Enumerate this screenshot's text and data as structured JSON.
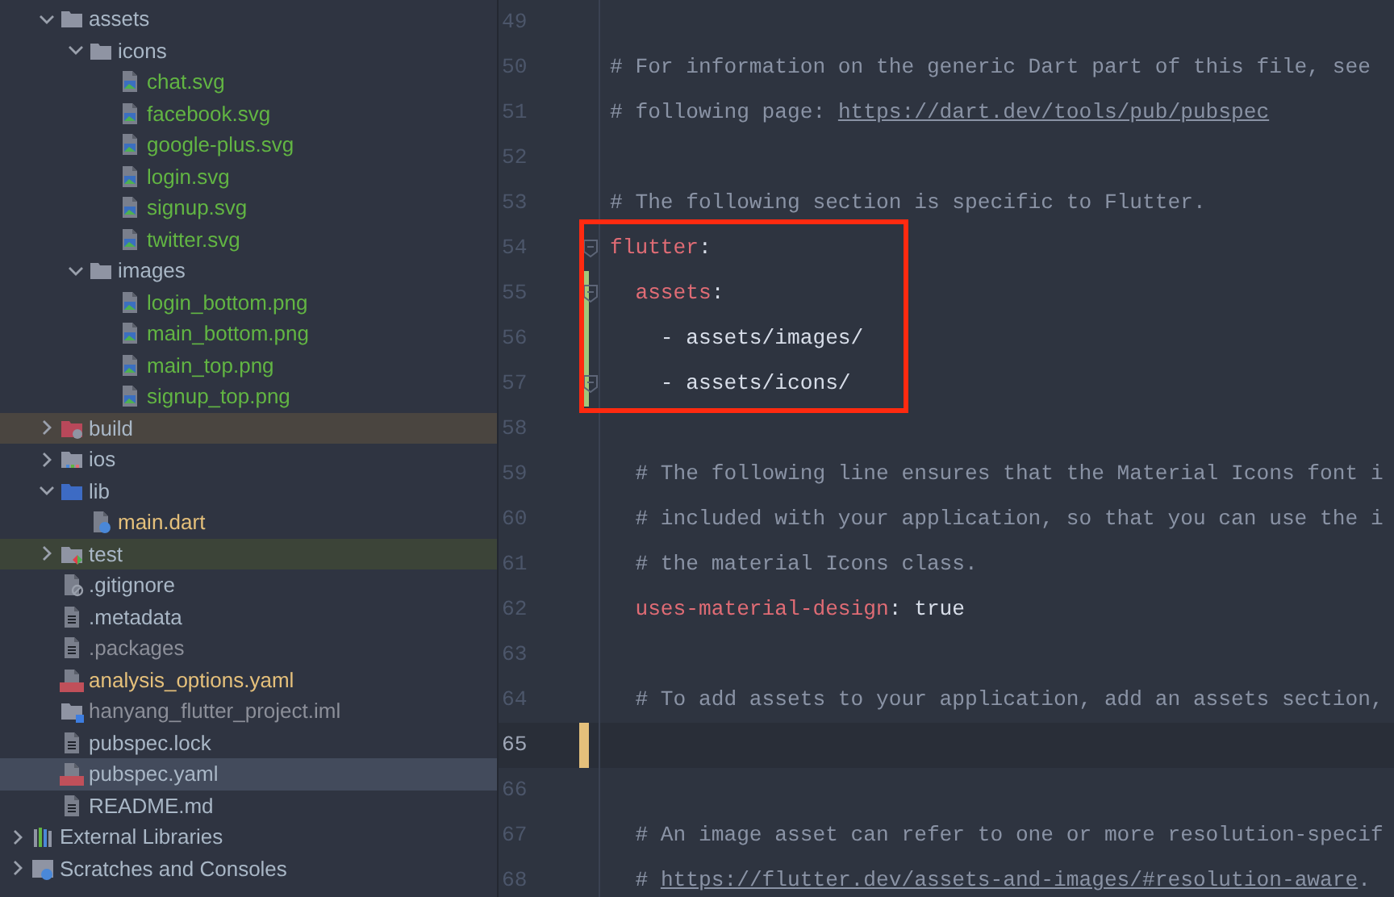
{
  "project_tree": [
    {
      "label": "assets",
      "kind": "folder",
      "expanded": true,
      "selected": false,
      "color": "#a9b7c6",
      "children": [
        {
          "label": "icons",
          "kind": "folder",
          "expanded": true,
          "selected": false,
          "color": "#a9b7c6",
          "children": [
            {
              "label": "chat.svg",
              "kind": "image",
              "selected": false,
              "color": "#62b543"
            },
            {
              "label": "facebook.svg",
              "kind": "image",
              "selected": false,
              "color": "#62b543"
            },
            {
              "label": "google-plus.svg",
              "kind": "image",
              "selected": false,
              "color": "#62b543"
            },
            {
              "label": "login.svg",
              "kind": "image",
              "selected": false,
              "color": "#62b543"
            },
            {
              "label": "signup.svg",
              "kind": "image",
              "selected": false,
              "color": "#62b543"
            },
            {
              "label": "twitter.svg",
              "kind": "image",
              "selected": false,
              "color": "#62b543"
            }
          ]
        },
        {
          "label": "images",
          "kind": "folder",
          "expanded": true,
          "selected": false,
          "color": "#a9b7c6",
          "children": [
            {
              "label": "login_bottom.png",
              "kind": "image",
              "selected": false,
              "color": "#62b543"
            },
            {
              "label": "main_bottom.png",
              "kind": "image",
              "selected": false,
              "color": "#62b543"
            },
            {
              "label": "main_top.png",
              "kind": "image",
              "selected": false,
              "color": "#62b543"
            },
            {
              "label": "signup_top.png",
              "kind": "image",
              "selected": false,
              "color": "#62b543"
            }
          ]
        }
      ]
    },
    {
      "label": "build",
      "kind": "excluded-folder",
      "expanded": false,
      "selected": false,
      "color": "#a9b7c6"
    },
    {
      "label": "ios",
      "kind": "ios-folder",
      "expanded": false,
      "selected": false,
      "color": "#a9b7c6"
    },
    {
      "label": "lib",
      "kind": "source-folder",
      "expanded": true,
      "selected": false,
      "color": "#a9b7c6",
      "children": [
        {
          "label": "main.dart",
          "kind": "dart",
          "selected": false,
          "color": "#e5c07b"
        }
      ]
    },
    {
      "label": "test",
      "kind": "test-folder",
      "expanded": false,
      "selected": false,
      "color": "#a9b7c6"
    },
    {
      "label": ".gitignore",
      "kind": "ignore",
      "selected": false,
      "color": "#a9b7c6"
    },
    {
      "label": ".metadata",
      "kind": "text",
      "selected": false,
      "color": "#a9b7c6"
    },
    {
      "label": ".packages",
      "kind": "text",
      "selected": false,
      "color": "#8c8f99"
    },
    {
      "label": "analysis_options.yaml",
      "kind": "yaml",
      "selected": false,
      "color": "#e5c07b"
    },
    {
      "label": "hanyang_flutter_project.iml",
      "kind": "module",
      "selected": false,
      "color": "#8c8f99"
    },
    {
      "label": "pubspec.lock",
      "kind": "text",
      "selected": false,
      "color": "#a9b7c6"
    },
    {
      "label": "pubspec.yaml",
      "kind": "yaml",
      "selected": true,
      "color": "#a9b7c6"
    },
    {
      "label": "README.md",
      "kind": "text",
      "selected": false,
      "color": "#a9b7c6"
    }
  ],
  "root_items": [
    {
      "label": "External Libraries",
      "kind": "libraries",
      "expanded": false
    },
    {
      "label": "Scratches and Consoles",
      "kind": "scratches",
      "expanded": false
    }
  ],
  "editor": {
    "lines": [
      {
        "number": "49"
      },
      {
        "number": "50",
        "spans": [
          {
            "kind": "comment",
            "text": "# For information on the generic Dart part of this file, see"
          }
        ]
      },
      {
        "number": "51",
        "spans": [
          {
            "kind": "comment",
            "text": "# following page: "
          },
          {
            "kind": "link",
            "text": "https://dart.dev/tools/pub/pubspec"
          }
        ]
      },
      {
        "number": "52"
      },
      {
        "number": "53",
        "spans": [
          {
            "kind": "comment",
            "text": "# The following section is specific to Flutter."
          }
        ]
      },
      {
        "number": "54",
        "fold": true,
        "boxed": true,
        "spans": [
          {
            "kind": "key",
            "text": "flutter"
          },
          {
            "kind": "plain",
            "text": ":"
          }
        ]
      },
      {
        "number": "55",
        "fold": true,
        "boxed": true,
        "color": "#a3c77a",
        "spans": [
          {
            "kind": "key",
            "text": "  assets"
          },
          {
            "kind": "plain",
            "text": ":"
          }
        ]
      },
      {
        "number": "56",
        "boxed": true,
        "color": "#a3c77a",
        "spans": [
          {
            "kind": "plain",
            "text": "    - assets/images/"
          }
        ]
      },
      {
        "number": "57",
        "fold": true,
        "boxed": true,
        "color": "#a3c77a",
        "spans": [
          {
            "kind": "plain",
            "text": "    - assets/icons/"
          }
        ]
      },
      {
        "number": "58"
      },
      {
        "number": "59",
        "spans": [
          {
            "kind": "comment",
            "text": "  # The following line ensures that the Material Icons font i"
          }
        ]
      },
      {
        "number": "60",
        "spans": [
          {
            "kind": "comment",
            "text": "  # included with your application, so that you can use the i"
          }
        ]
      },
      {
        "number": "61",
        "spans": [
          {
            "kind": "comment",
            "text": "  # the material Icons class."
          }
        ]
      },
      {
        "number": "62",
        "spans": [
          {
            "kind": "key",
            "text": "  uses-material-design"
          },
          {
            "kind": "plain",
            "text": ": true"
          }
        ]
      },
      {
        "number": "63"
      },
      {
        "number": "64",
        "spans": [
          {
            "kind": "comment",
            "text": "  # To add assets to your application, add an assets section,"
          }
        ]
      },
      {
        "number": "65",
        "current": true,
        "color": "#e5c07b"
      },
      {
        "number": "66"
      },
      {
        "number": "67",
        "spans": [
          {
            "kind": "comment",
            "text": "  # An image asset can refer to one or more resolution-specif"
          }
        ]
      },
      {
        "number": "68",
        "spans": [
          {
            "kind": "comment",
            "text": "  # "
          },
          {
            "kind": "link",
            "text": "https://flutter.dev/assets-and-images/#resolution-aware"
          },
          {
            "kind": "comment",
            "text": "."
          }
        ]
      }
    ]
  }
}
